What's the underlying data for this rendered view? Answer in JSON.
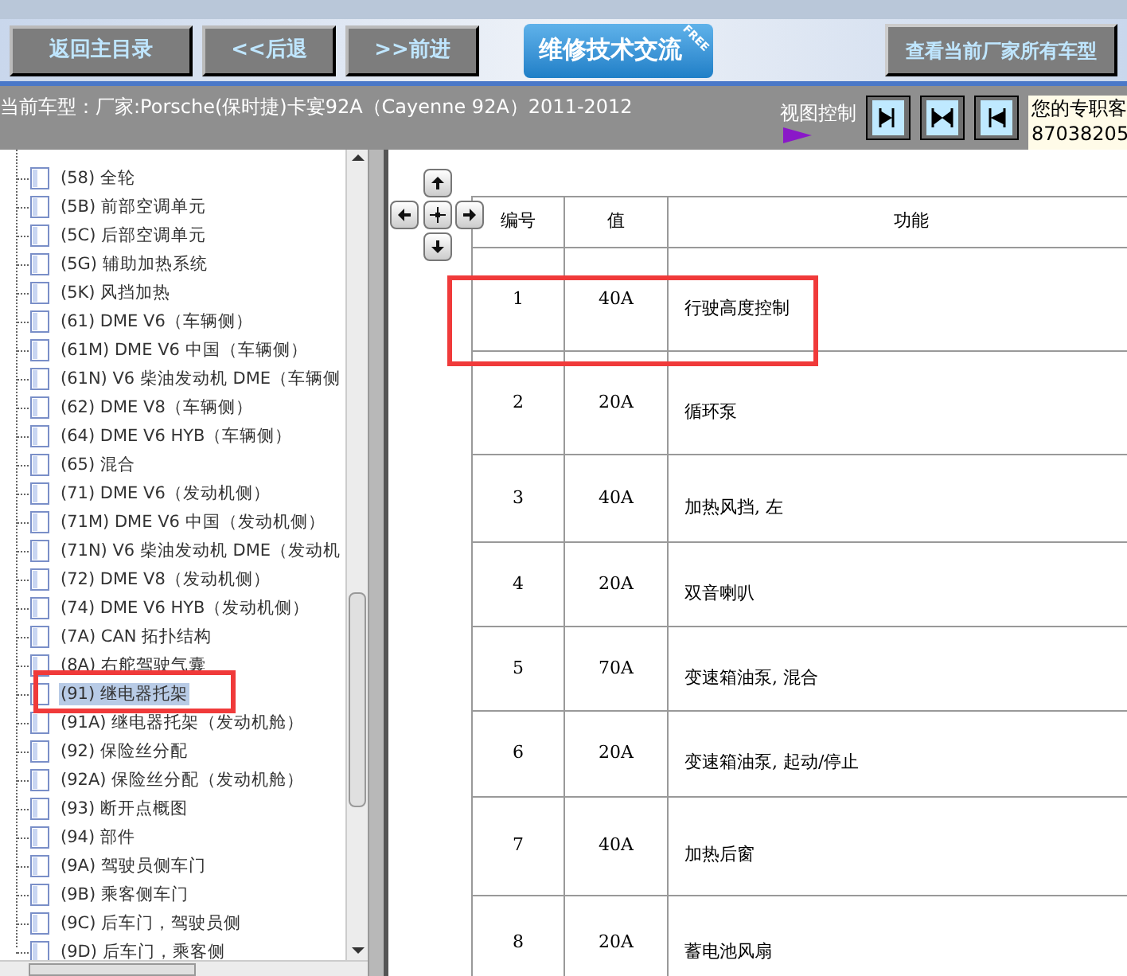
{
  "toolbar": {
    "buttons": [
      "返回主目录",
      "<<后退",
      ">>前进"
    ],
    "exchange_button": {
      "label": "维修技术交流",
      "badge": "FREE"
    },
    "all_models_button": "查看当前厂家所有车型"
  },
  "info_bar": {
    "current_model": "当前车型：厂家:Porsche(保时捷)卡宴92A（Cayenne 92A）2011-2012",
    "view_control_label": "视图控制",
    "contact": [
      "您的专职客",
      "87038205"
    ]
  },
  "tree": {
    "items": [
      {
        "label": "(58) 全轮",
        "selected": false
      },
      {
        "label": "(5B) 前部空调单元",
        "selected": false
      },
      {
        "label": "(5C) 后部空调单元",
        "selected": false
      },
      {
        "label": "(5G) 辅助加热系统",
        "selected": false
      },
      {
        "label": "(5K) 风挡加热",
        "selected": false
      },
      {
        "label": "(61) DME V6（车辆侧）",
        "selected": false
      },
      {
        "label": "(61M) DME V6 中国（车辆侧）",
        "selected": false
      },
      {
        "label": "(61N) V6 柴油发动机 DME（车辆侧",
        "selected": false
      },
      {
        "label": "(62) DME V8（车辆侧）",
        "selected": false
      },
      {
        "label": "(64) DME V6 HYB（车辆侧）",
        "selected": false
      },
      {
        "label": "(65) 混合",
        "selected": false
      },
      {
        "label": "(71) DME V6（发动机侧）",
        "selected": false
      },
      {
        "label": "(71M) DME V6 中国（发动机侧）",
        "selected": false
      },
      {
        "label": "(71N) V6 柴油发动机 DME（发动机",
        "selected": false
      },
      {
        "label": "(72) DME V8（发动机侧）",
        "selected": false
      },
      {
        "label": "(74) DME V6 HYB（发动机侧）",
        "selected": false
      },
      {
        "label": "(7A) CAN 拓扑结构",
        "selected": false
      },
      {
        "label": "(8A) 右舵驾驶气囊",
        "selected": false
      },
      {
        "label": "(91) 继电器托架",
        "selected": true
      },
      {
        "label": "(91A) 继电器托架（发动机舱）",
        "selected": false
      },
      {
        "label": "(92) 保险丝分配",
        "selected": false
      },
      {
        "label": "(92A) 保险丝分配（发动机舱）",
        "selected": false
      },
      {
        "label": "(93) 断开点概图",
        "selected": false
      },
      {
        "label": "(94) 部件",
        "selected": false
      },
      {
        "label": "(9A) 驾驶员侧车门",
        "selected": false
      },
      {
        "label": "(9B) 乘客侧车门",
        "selected": false
      },
      {
        "label": "(9C) 后车门，驾驶员侧",
        "selected": false
      },
      {
        "label": "(9D) 后车门，乘客侧",
        "selected": false
      }
    ]
  },
  "table": {
    "columns": [
      "编号",
      "值",
      "功能"
    ],
    "rows": [
      {
        "cells": [
          "1",
          "40A",
          "行驶高度控制"
        ]
      },
      {
        "cells": [
          "2",
          "20A",
          "循环泵"
        ]
      },
      {
        "cells": [
          "3",
          "40A",
          "加热风挡, 左"
        ]
      },
      {
        "cells": [
          "4",
          "20A",
          "双音喇叭"
        ]
      },
      {
        "cells": [
          "5",
          "70A",
          "变速箱油泵, 混合"
        ]
      },
      {
        "cells": [
          "6",
          "20A",
          "变速箱油泵, 起动/停止"
        ]
      },
      {
        "cells": [
          "7",
          "40A",
          "加热后窗"
        ]
      },
      {
        "cells": [
          "8",
          "20A",
          "蓄电池风扇"
        ]
      }
    ]
  }
}
